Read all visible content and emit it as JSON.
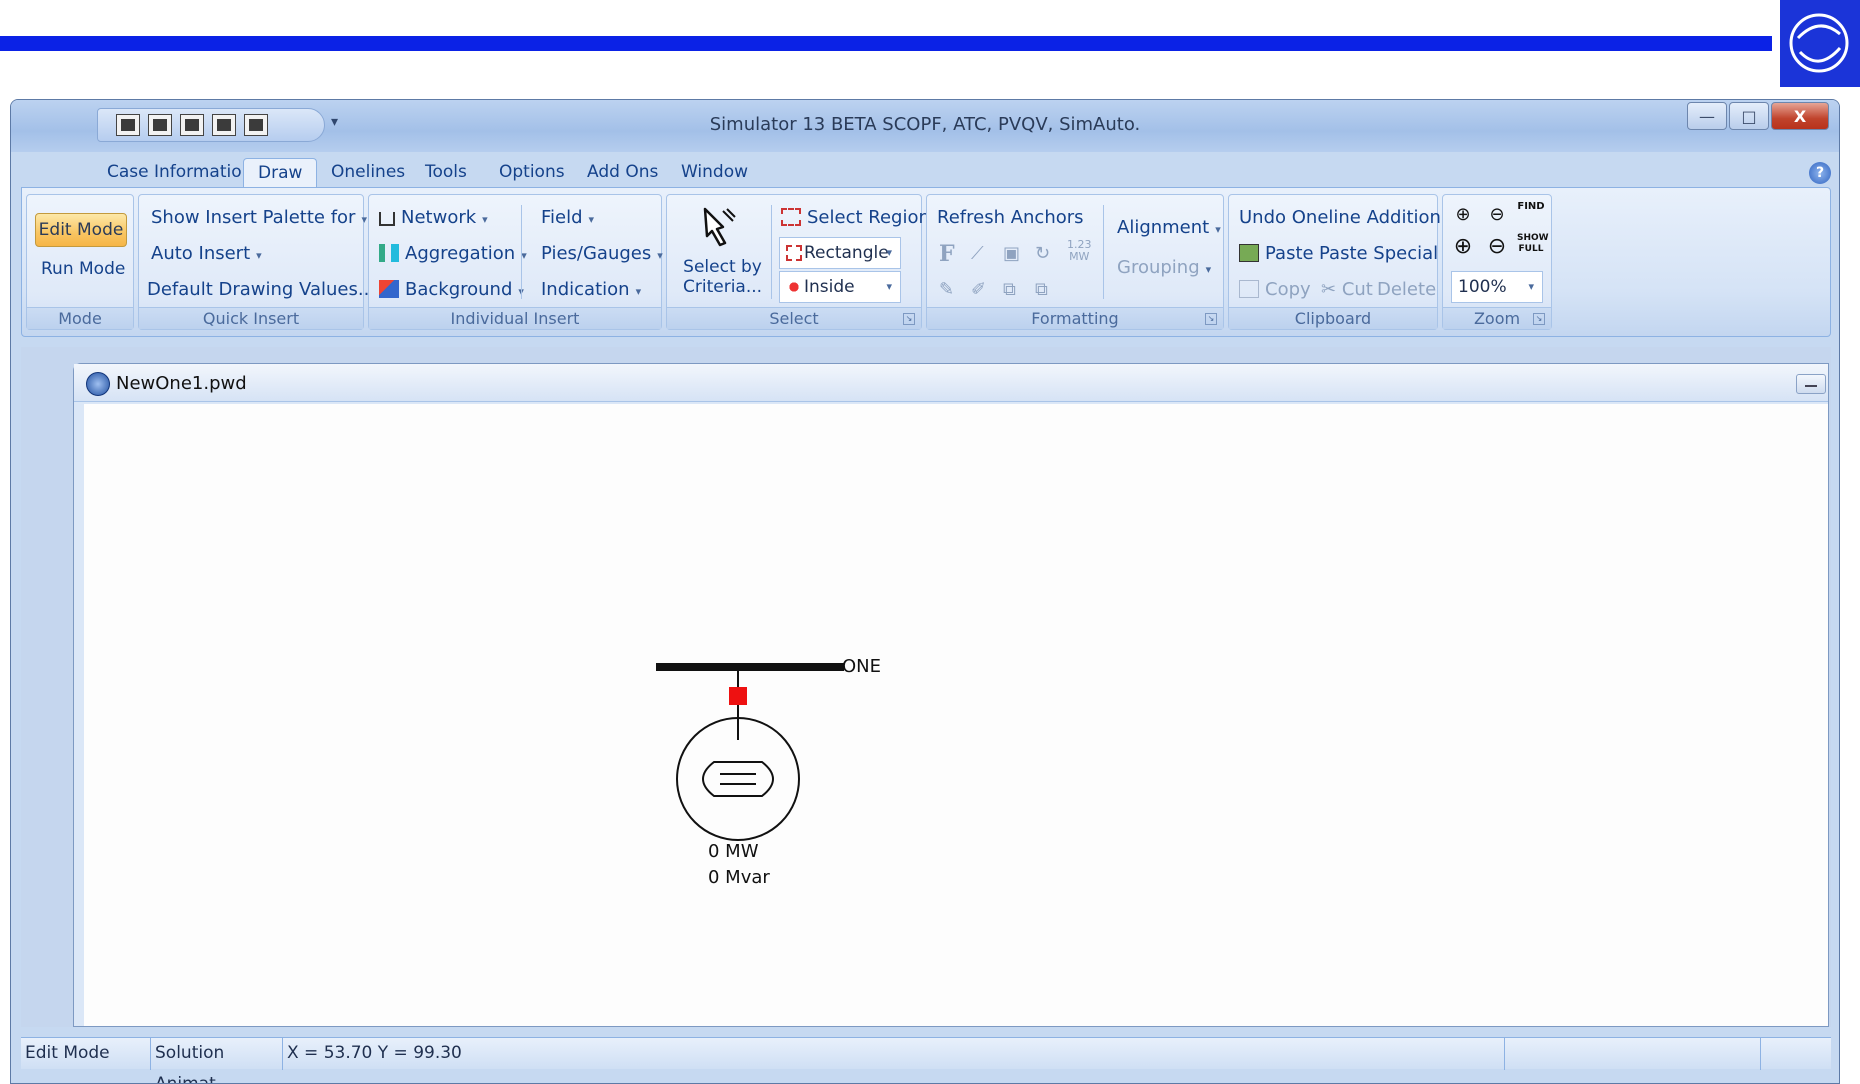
{
  "app": {
    "window_title": "Simulator 13 BETA SCOPF, ATC, PVQV, SimAuto.",
    "window_controls": {
      "minimize": "—",
      "maximize": "□",
      "close": "X"
    },
    "help_glyph": "?"
  },
  "tabs": [
    {
      "label": "Case Information",
      "active": false
    },
    {
      "label": "Draw",
      "active": true
    },
    {
      "label": "Onelines",
      "active": false
    },
    {
      "label": "Tools",
      "active": false
    },
    {
      "label": "Options",
      "active": false
    },
    {
      "label": "Add Ons",
      "active": false
    },
    {
      "label": "Window",
      "active": false
    }
  ],
  "ribbon": {
    "mode": {
      "label": "Mode",
      "edit_mode": "Edit Mode",
      "run_mode": "Run Mode"
    },
    "quick_insert": {
      "label": "Quick Insert",
      "show_insert_palette": "Show Insert Palette for",
      "auto_insert": "Auto Insert",
      "default_drawing_values": "Default Drawing Values..."
    },
    "individual_insert": {
      "label": "Individual Insert",
      "network": "Network",
      "aggregation": "Aggregation",
      "background": "Background",
      "field": "Field",
      "pies_gauges": "Pies/Gauges",
      "indication": "Indication"
    },
    "select": {
      "label": "Select",
      "select_by_criteria_line1": "Select by",
      "select_by_criteria_line2": "Criteria...",
      "select_region": "Select Region",
      "shape_value": "Rectangle",
      "region_value": "Inside"
    },
    "formatting": {
      "label": "Formatting",
      "refresh_anchors": "Refresh Anchors",
      "alignment": "Alignment",
      "grouping": "Grouping",
      "mw_badge_line1": "1.23",
      "mw_badge_line2": "MW"
    },
    "clipboard": {
      "label": "Clipboard",
      "undo": "Undo Oneline Addition",
      "paste": "Paste",
      "paste_special": "Paste Special",
      "copy": "Copy",
      "cut": "Cut",
      "delete": "Delete"
    },
    "zoom": {
      "label": "Zoom",
      "value": "100%",
      "find_label": "FIND",
      "show_full_label": "SHOW FULL"
    }
  },
  "document": {
    "name": "NewOne1.pwd",
    "oneline": {
      "bus_name": "ONE",
      "gen_mw": "0 MW",
      "gen_mvar": "0 Mvar",
      "breaker_color": "#ee1111"
    }
  },
  "status_bar": {
    "mode": "Edit Mode",
    "animation": "Solution Animat",
    "coords": "X = 53.70 Y = 99.30"
  },
  "colors": {
    "header_bar": "#0b22e6",
    "active_mode": "#f8c562",
    "ribbon_text": "#15428b"
  }
}
